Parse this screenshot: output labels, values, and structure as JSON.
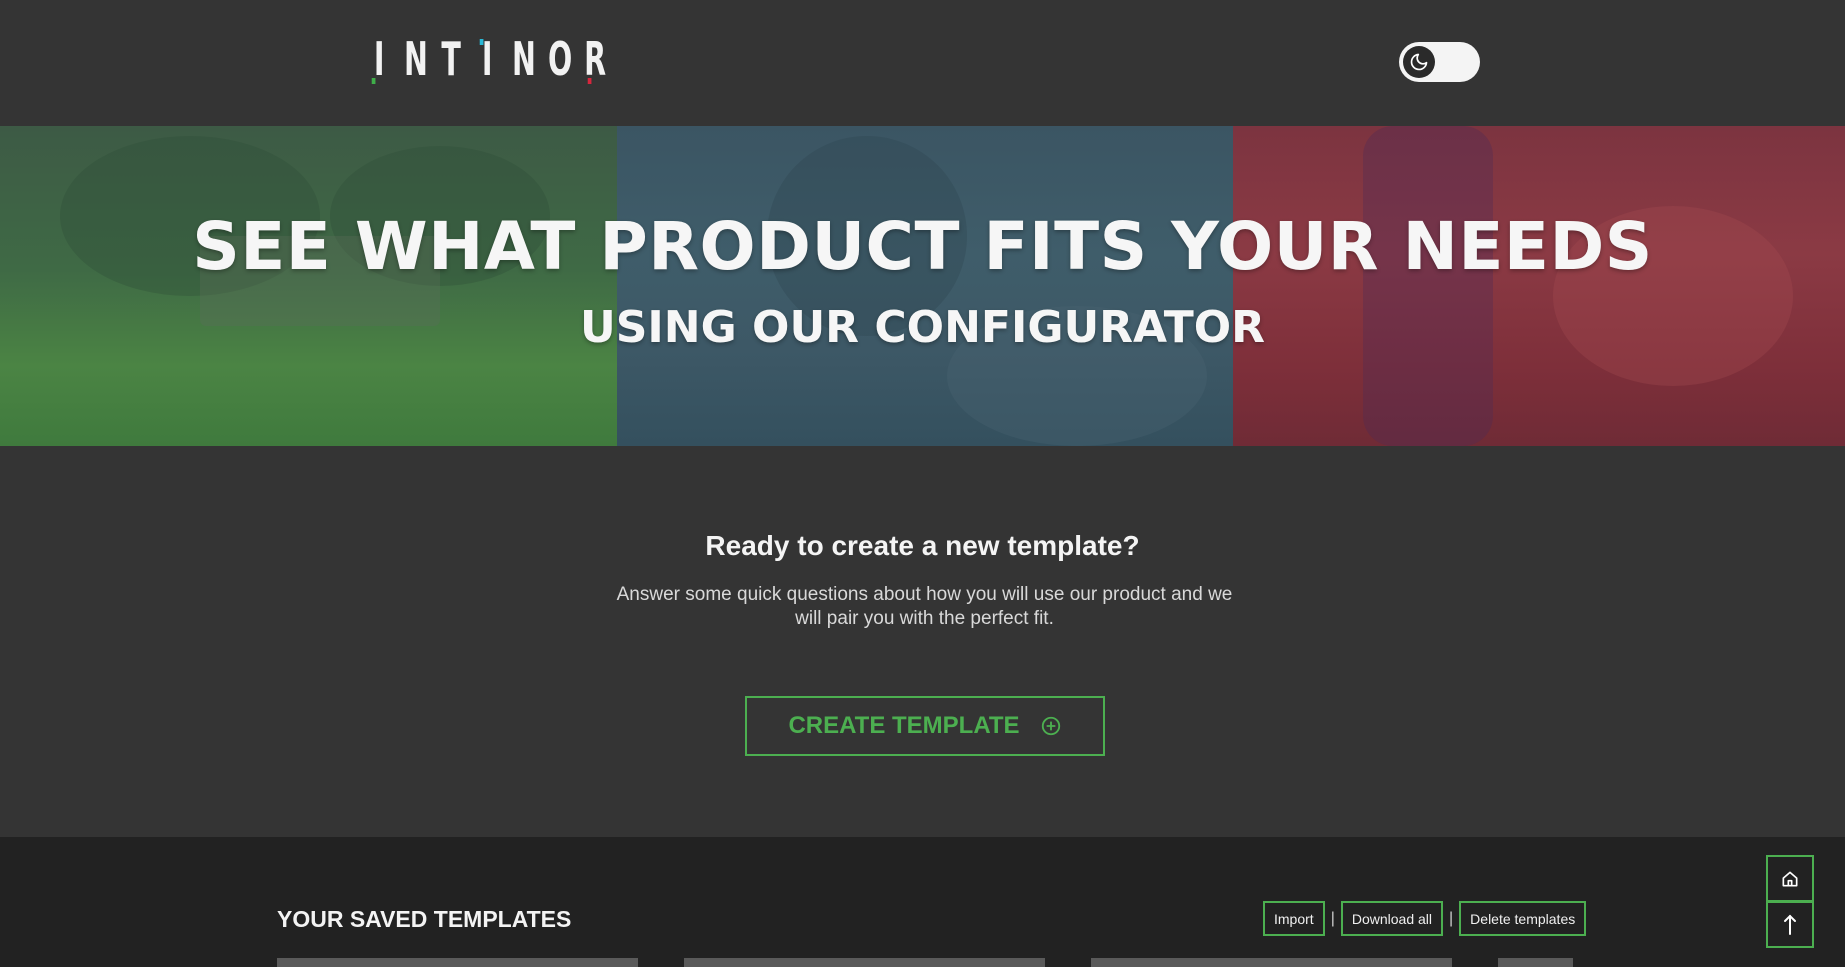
{
  "header": {
    "logo_letters": [
      "I",
      "N",
      "T",
      "I",
      "N",
      "O",
      "R"
    ],
    "logo_accent_colors": {
      "green": "#3fae49",
      "cyan": "#29b8d6",
      "red": "#d7263d"
    },
    "theme_toggle_icon": "moon-icon"
  },
  "hero": {
    "title": "SEE WHAT PRODUCT FITS YOUR NEEDS",
    "subtitle": "USING OUR CONFIGURATOR",
    "panel_colors": [
      "#3f6a45",
      "#3f5d6a",
      "#8b3a44"
    ]
  },
  "cta": {
    "heading": "Ready to create a new template?",
    "text": "Answer some quick questions about how you will use our product and we will pair you with the perfect fit.",
    "button_label": "CREATE TEMPLATE",
    "button_icon": "plus-circle-icon"
  },
  "saved": {
    "title": "YOUR SAVED TEMPLATES",
    "actions": [
      "Import",
      "Download all",
      "Delete templates"
    ],
    "separator": "|"
  },
  "floating": {
    "home_icon": "home-icon",
    "top_icon": "arrow-up-icon"
  },
  "colors": {
    "background": "#343434",
    "dark_section": "#222222",
    "accent": "#4caf50"
  }
}
